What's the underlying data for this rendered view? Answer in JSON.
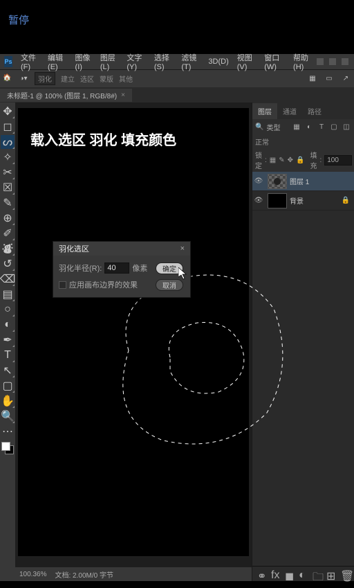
{
  "ui": {
    "pause_label": "暂停",
    "menubar": {
      "items": [
        "文件(F)",
        "编辑(E)",
        "图像(I)",
        "图层(L)",
        "文字(Y)",
        "选择(S)",
        "滤镜(T)",
        "3D(D)",
        "视图(V)",
        "窗口(W)",
        "帮助(H)"
      ]
    },
    "options": {
      "feather_label": "羽化",
      "style_label": "建立",
      "select_label": "选区",
      "mask_label": "蒙版",
      "other_label": "其他"
    },
    "document": {
      "tab_title": "未标题-1 @ 100% (图层 1, RGB/8#)",
      "status_zoom": "100.36%",
      "status_docinfo": "文档: 2.00M/0 字节"
    },
    "canvas_title": "载入选区 羽化 填充颜色",
    "dialog": {
      "title": "羽化选区",
      "radius_label": "羽化半径(R):",
      "radius_value": "40",
      "unit": "像素",
      "apply_canvas": "应用画布边界的效果",
      "ok": "确定",
      "cancel": "取消"
    },
    "panels": {
      "tabs": [
        "图层",
        "通道",
        "路径"
      ],
      "kind_label": "类型",
      "normal_label": "正常",
      "lock_label": "锁定",
      "fill_label": "填充",
      "fill_value": "100",
      "layers": [
        {
          "name": "图层 1",
          "selected": true,
          "thumb": "checker"
        },
        {
          "name": "背景",
          "selected": false,
          "thumb": "black"
        }
      ]
    },
    "tools": {
      "names": [
        "move",
        "marquee",
        "lasso",
        "wand",
        "crop",
        "frame",
        "eyedropper",
        "healing",
        "brush",
        "stamp",
        "history-brush",
        "eraser",
        "gradient",
        "blur",
        "dodge",
        "pen",
        "type",
        "path-select",
        "rectangle",
        "hand",
        "zoom"
      ]
    }
  }
}
